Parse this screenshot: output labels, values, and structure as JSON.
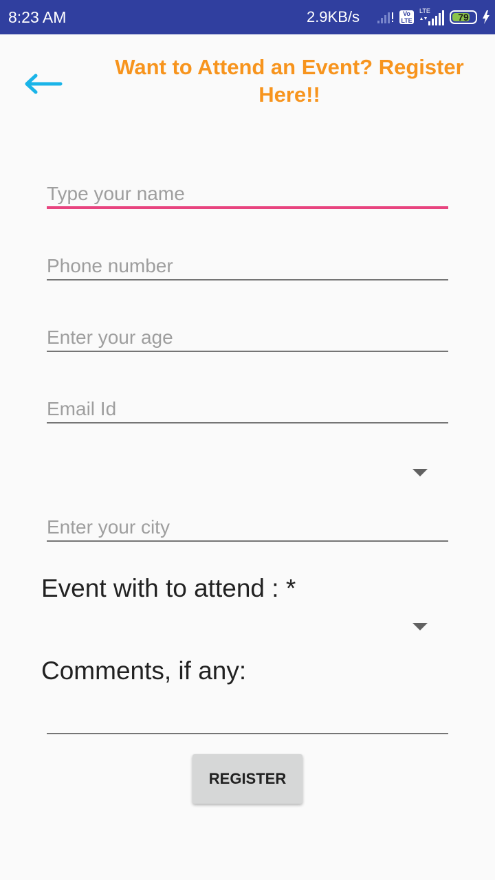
{
  "status_bar": {
    "time": "8:23 AM",
    "network_speed": "2.9KB/s",
    "volte_label": "Vo LTE",
    "lte_label": "LTE",
    "battery_level": "79",
    "icons": [
      "signal-icon",
      "volte-icon",
      "lte-signal-icon",
      "battery-icon",
      "charging-icon"
    ],
    "colors": {
      "background": "#303f9f",
      "battery_fill": "#8bc34a"
    }
  },
  "header": {
    "back_icon": "arrow-left-icon",
    "title": "Want to Attend an Event? Register Here!!",
    "colors": {
      "back_arrow": "#1ab4e8",
      "title": "#f7941d"
    }
  },
  "form": {
    "name_placeholder": "Type your name",
    "phone_placeholder": "Phone number",
    "age_placeholder": "Enter your age",
    "email_placeholder": "Email Id",
    "city_placeholder": "Enter your city",
    "event_label": "Event with to attend : *",
    "comments_label": "Comments, if any:",
    "comments_value": "",
    "focus_color": "#e8447f",
    "register_label": "REGISTER"
  }
}
